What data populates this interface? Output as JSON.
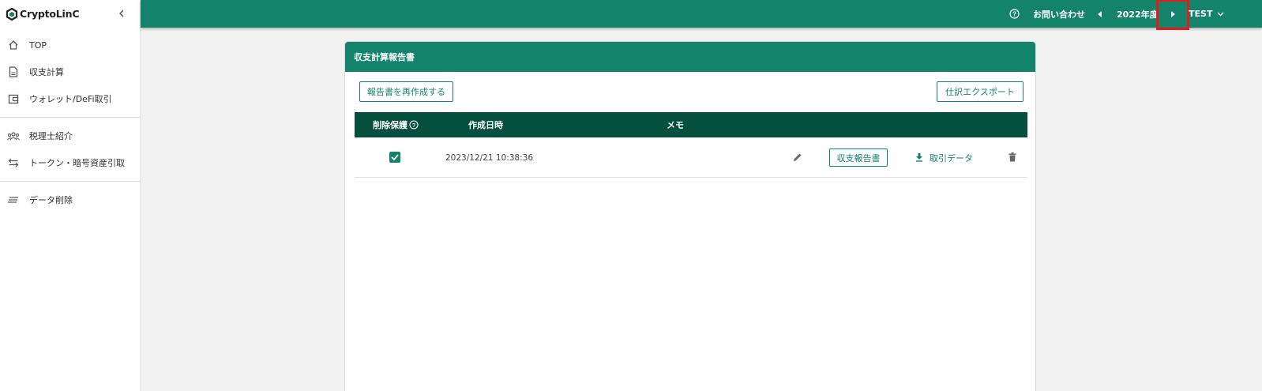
{
  "sidebar": {
    "logo_text": "CryptoLinC",
    "items": [
      {
        "label": "TOP",
        "icon": "home-icon"
      },
      {
        "label": "収支計算",
        "icon": "document-icon"
      },
      {
        "label": "ウォレット/DeFi取引",
        "icon": "wallet-icon"
      },
      {
        "label": "税理士紹介",
        "icon": "people-icon"
      },
      {
        "label": "トークン・暗号資産引取",
        "icon": "swap-icon"
      },
      {
        "label": "データ削除",
        "icon": "lines-icon"
      }
    ]
  },
  "topbar": {
    "contact_label": "お問い合わせ",
    "year_label": "2022年度",
    "user_label": "TEST"
  },
  "card": {
    "title": "収支計算報告書",
    "regenerate_label": "報告書を再作成する",
    "export_label": "仕訳エクスポート",
    "columns": {
      "protect": "削除保護",
      "created": "作成日時",
      "memo": "メモ"
    },
    "rows": [
      {
        "protected": true,
        "created": "2023/12/21 10:38:36",
        "memo": "",
        "report_label": "収支報告書",
        "download_label": "取引データ"
      }
    ]
  },
  "colors": {
    "brand": "#13846b",
    "table_header": "#054f3f",
    "highlight": "#e01c1c"
  }
}
